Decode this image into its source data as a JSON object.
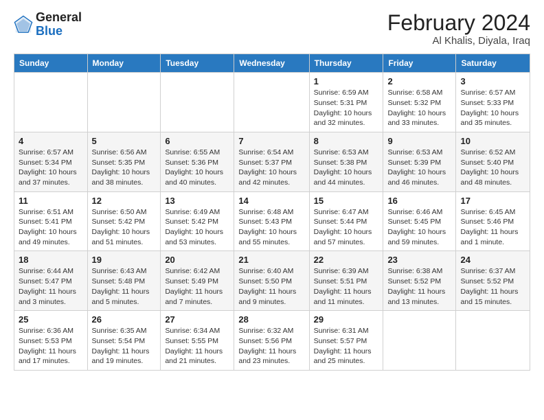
{
  "header": {
    "logo_general": "General",
    "logo_blue": "Blue",
    "title": "February 2024",
    "subtitle": "Al Khalis, Diyala, Iraq"
  },
  "days_of_week": [
    "Sunday",
    "Monday",
    "Tuesday",
    "Wednesday",
    "Thursday",
    "Friday",
    "Saturday"
  ],
  "weeks": [
    [
      {
        "day": "",
        "info": ""
      },
      {
        "day": "",
        "info": ""
      },
      {
        "day": "",
        "info": ""
      },
      {
        "day": "",
        "info": ""
      },
      {
        "day": "1",
        "info": "Sunrise: 6:59 AM\nSunset: 5:31 PM\nDaylight: 10 hours\nand 32 minutes."
      },
      {
        "day": "2",
        "info": "Sunrise: 6:58 AM\nSunset: 5:32 PM\nDaylight: 10 hours\nand 33 minutes."
      },
      {
        "day": "3",
        "info": "Sunrise: 6:57 AM\nSunset: 5:33 PM\nDaylight: 10 hours\nand 35 minutes."
      }
    ],
    [
      {
        "day": "4",
        "info": "Sunrise: 6:57 AM\nSunset: 5:34 PM\nDaylight: 10 hours\nand 37 minutes."
      },
      {
        "day": "5",
        "info": "Sunrise: 6:56 AM\nSunset: 5:35 PM\nDaylight: 10 hours\nand 38 minutes."
      },
      {
        "day": "6",
        "info": "Sunrise: 6:55 AM\nSunset: 5:36 PM\nDaylight: 10 hours\nand 40 minutes."
      },
      {
        "day": "7",
        "info": "Sunrise: 6:54 AM\nSunset: 5:37 PM\nDaylight: 10 hours\nand 42 minutes."
      },
      {
        "day": "8",
        "info": "Sunrise: 6:53 AM\nSunset: 5:38 PM\nDaylight: 10 hours\nand 44 minutes."
      },
      {
        "day": "9",
        "info": "Sunrise: 6:53 AM\nSunset: 5:39 PM\nDaylight: 10 hours\nand 46 minutes."
      },
      {
        "day": "10",
        "info": "Sunrise: 6:52 AM\nSunset: 5:40 PM\nDaylight: 10 hours\nand 48 minutes."
      }
    ],
    [
      {
        "day": "11",
        "info": "Sunrise: 6:51 AM\nSunset: 5:41 PM\nDaylight: 10 hours\nand 49 minutes."
      },
      {
        "day": "12",
        "info": "Sunrise: 6:50 AM\nSunset: 5:42 PM\nDaylight: 10 hours\nand 51 minutes."
      },
      {
        "day": "13",
        "info": "Sunrise: 6:49 AM\nSunset: 5:42 PM\nDaylight: 10 hours\nand 53 minutes."
      },
      {
        "day": "14",
        "info": "Sunrise: 6:48 AM\nSunset: 5:43 PM\nDaylight: 10 hours\nand 55 minutes."
      },
      {
        "day": "15",
        "info": "Sunrise: 6:47 AM\nSunset: 5:44 PM\nDaylight: 10 hours\nand 57 minutes."
      },
      {
        "day": "16",
        "info": "Sunrise: 6:46 AM\nSunset: 5:45 PM\nDaylight: 10 hours\nand 59 minutes."
      },
      {
        "day": "17",
        "info": "Sunrise: 6:45 AM\nSunset: 5:46 PM\nDaylight: 11 hours\nand 1 minute."
      }
    ],
    [
      {
        "day": "18",
        "info": "Sunrise: 6:44 AM\nSunset: 5:47 PM\nDaylight: 11 hours\nand 3 minutes."
      },
      {
        "day": "19",
        "info": "Sunrise: 6:43 AM\nSunset: 5:48 PM\nDaylight: 11 hours\nand 5 minutes."
      },
      {
        "day": "20",
        "info": "Sunrise: 6:42 AM\nSunset: 5:49 PM\nDaylight: 11 hours\nand 7 minutes."
      },
      {
        "day": "21",
        "info": "Sunrise: 6:40 AM\nSunset: 5:50 PM\nDaylight: 11 hours\nand 9 minutes."
      },
      {
        "day": "22",
        "info": "Sunrise: 6:39 AM\nSunset: 5:51 PM\nDaylight: 11 hours\nand 11 minutes."
      },
      {
        "day": "23",
        "info": "Sunrise: 6:38 AM\nSunset: 5:52 PM\nDaylight: 11 hours\nand 13 minutes."
      },
      {
        "day": "24",
        "info": "Sunrise: 6:37 AM\nSunset: 5:52 PM\nDaylight: 11 hours\nand 15 minutes."
      }
    ],
    [
      {
        "day": "25",
        "info": "Sunrise: 6:36 AM\nSunset: 5:53 PM\nDaylight: 11 hours\nand 17 minutes."
      },
      {
        "day": "26",
        "info": "Sunrise: 6:35 AM\nSunset: 5:54 PM\nDaylight: 11 hours\nand 19 minutes."
      },
      {
        "day": "27",
        "info": "Sunrise: 6:34 AM\nSunset: 5:55 PM\nDaylight: 11 hours\nand 21 minutes."
      },
      {
        "day": "28",
        "info": "Sunrise: 6:32 AM\nSunset: 5:56 PM\nDaylight: 11 hours\nand 23 minutes."
      },
      {
        "day": "29",
        "info": "Sunrise: 6:31 AM\nSunset: 5:57 PM\nDaylight: 11 hours\nand 25 minutes."
      },
      {
        "day": "",
        "info": ""
      },
      {
        "day": "",
        "info": ""
      }
    ]
  ]
}
